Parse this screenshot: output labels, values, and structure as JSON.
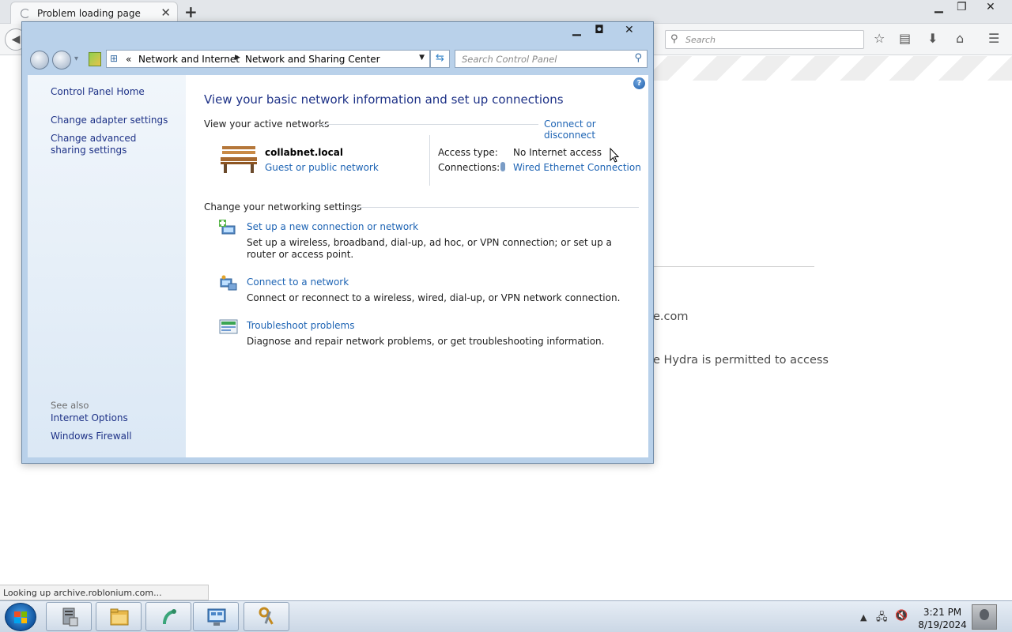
{
  "browser": {
    "tab_title": "Problem loading page",
    "new_tab": "+",
    "search_placeholder": "Search",
    "status_text": "Looking up archive.roblonium.com...",
    "background_fragments": {
      "line1": "e.com",
      "line2": "e Hydra is permitted to access"
    }
  },
  "window": {
    "breadcrumb_prefix": "«",
    "breadcrumb": [
      "Network and Internet",
      "Network and Sharing Center"
    ],
    "search_placeholder": "Search Control Panel",
    "sidebar": {
      "links": [
        "Control Panel Home",
        "Change adapter settings",
        "Change advanced sharing settings"
      ],
      "see_also_label": "See also",
      "see_also": [
        "Internet Options",
        "Windows Firewall"
      ]
    },
    "content": {
      "heading": "View your basic network information and set up connections",
      "active_networks_label": "View your active networks",
      "connect_link": "Connect or disconnect",
      "network": {
        "name": "collabnet.local",
        "type": "Guest or public network",
        "access_type_label": "Access type:",
        "access_type_value": "No Internet access",
        "connections_label": "Connections:",
        "connections_value": "Wired Ethernet Connection"
      },
      "settings_label": "Change your networking settings",
      "tasks": [
        {
          "title": "Set up a new connection or network",
          "desc": "Set up a wireless, broadband, dial-up, ad hoc, or VPN connection; or set up a router or access point."
        },
        {
          "title": "Connect to a network",
          "desc": "Connect or reconnect to a wireless, wired, dial-up, or VPN network connection."
        },
        {
          "title": "Troubleshoot problems",
          "desc": "Diagnose and repair network problems, or get troubleshooting information."
        }
      ]
    }
  },
  "taskbar": {
    "time": "3:21 PM",
    "date": "8/19/2024"
  },
  "colors": {
    "link": "#1e64b4",
    "heading": "#1e3287",
    "window_frame": "#b9d1ea"
  }
}
